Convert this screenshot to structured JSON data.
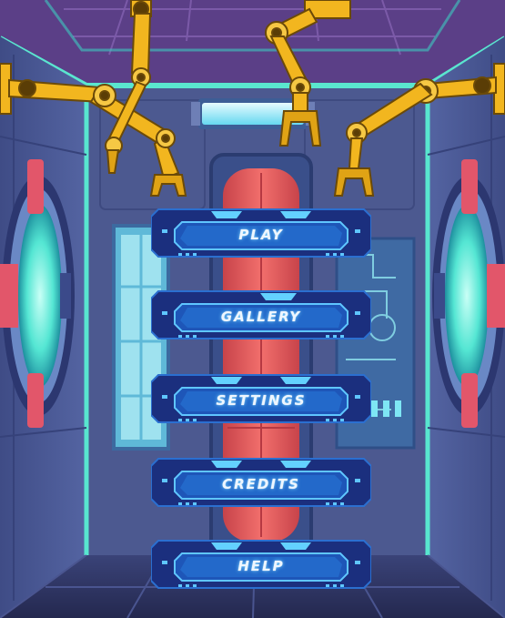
{
  "menu": {
    "items": [
      {
        "id": "play",
        "label": "PLAY"
      },
      {
        "id": "gallery",
        "label": "GALLERY"
      },
      {
        "id": "settings",
        "label": "SETTINGS"
      },
      {
        "id": "credits",
        "label": "CREDITS"
      },
      {
        "id": "help",
        "label": "HELP"
      }
    ]
  },
  "colors": {
    "wall": "#4a5790",
    "ceiling": "#5a3f86",
    "trim": "#58e6cf",
    "arm": "#f2b61f",
    "button_fill": "#1a3a8a",
    "button_border": "#2a8fe0",
    "porthole_glow": "#48e8d4",
    "pod": "#e0585c"
  },
  "icons": {
    "left_porthole": "porthole-window-icon",
    "right_porthole": "porthole-window-icon",
    "robot_arm": "robotic-arm-icon",
    "ceiling_light": "ceiling-light-icon"
  }
}
